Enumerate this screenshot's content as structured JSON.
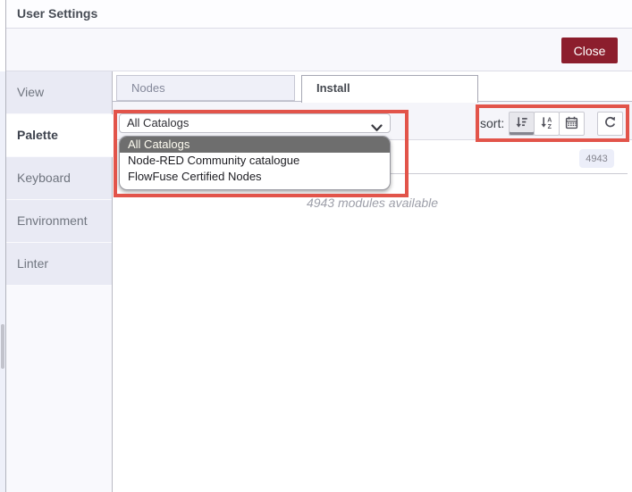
{
  "dialog": {
    "title": "User Settings",
    "close_label": "Close"
  },
  "sidebar": {
    "items": [
      {
        "label": "View",
        "active": false
      },
      {
        "label": "Palette",
        "active": true
      },
      {
        "label": "Keyboard",
        "active": false
      },
      {
        "label": "Environment",
        "active": false
      },
      {
        "label": "Linter",
        "active": false
      }
    ]
  },
  "palette_tabs": [
    {
      "label": "Nodes",
      "active": false
    },
    {
      "label": "Install",
      "active": true
    }
  ],
  "toolbar": {
    "catalog_select": {
      "value": "All Catalogs",
      "options": [
        "All Catalogs",
        "Node-RED Community catalogue",
        "FlowFuse Certified Nodes"
      ],
      "selected_index": 0
    },
    "sort_label": "sort:",
    "sort_buttons": [
      {
        "icon": "sort-amount-desc-icon",
        "active": true
      },
      {
        "icon": "sort-alpha-asc-icon",
        "active": false
      },
      {
        "icon": "calendar-icon",
        "active": false
      }
    ],
    "refresh_icon": "refresh-icon"
  },
  "install_panel": {
    "count_badge": "4943",
    "status_text": "4943 modules available"
  },
  "icons": {
    "select_chevron": "chevron-down-icon"
  },
  "colors": {
    "close_bg": "#8C1E2D",
    "annotation_red": "#E2544A",
    "selected_option_bg": "#6E6E6E"
  }
}
